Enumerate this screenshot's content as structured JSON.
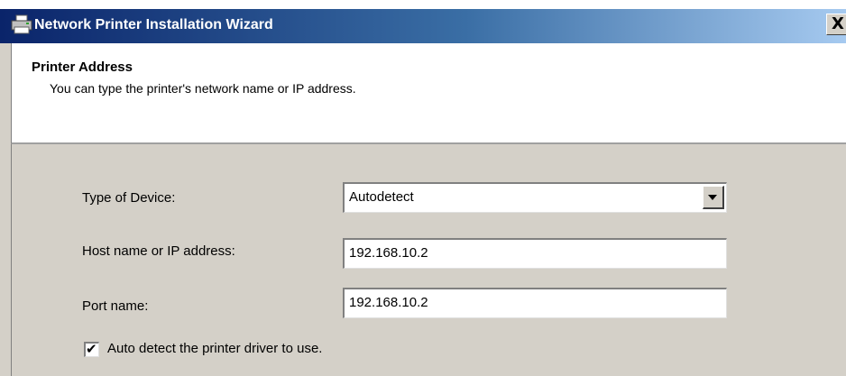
{
  "window": {
    "title": "Network Printer Installation Wizard",
    "close_symbol": "X",
    "icon": "printer-icon"
  },
  "header": {
    "title": "Printer Address",
    "subtitle": "You can type the printer's network name or IP address."
  },
  "form": {
    "device_type": {
      "label": "Type of Device:",
      "value": "Autodetect"
    },
    "host": {
      "label": "Host name or IP address:",
      "value": "192.168.10.2"
    },
    "port": {
      "label": "Port name:",
      "value": "192.168.10.2"
    },
    "auto_detect": {
      "label": "Auto detect the printer driver to use.",
      "checked": true,
      "check_mark": "✔"
    }
  },
  "colors": {
    "titlebar_start": "#0a246a",
    "titlebar_end": "#a6caf0",
    "dialog_background": "#d4d0c8",
    "header_background": "#ffffff"
  }
}
